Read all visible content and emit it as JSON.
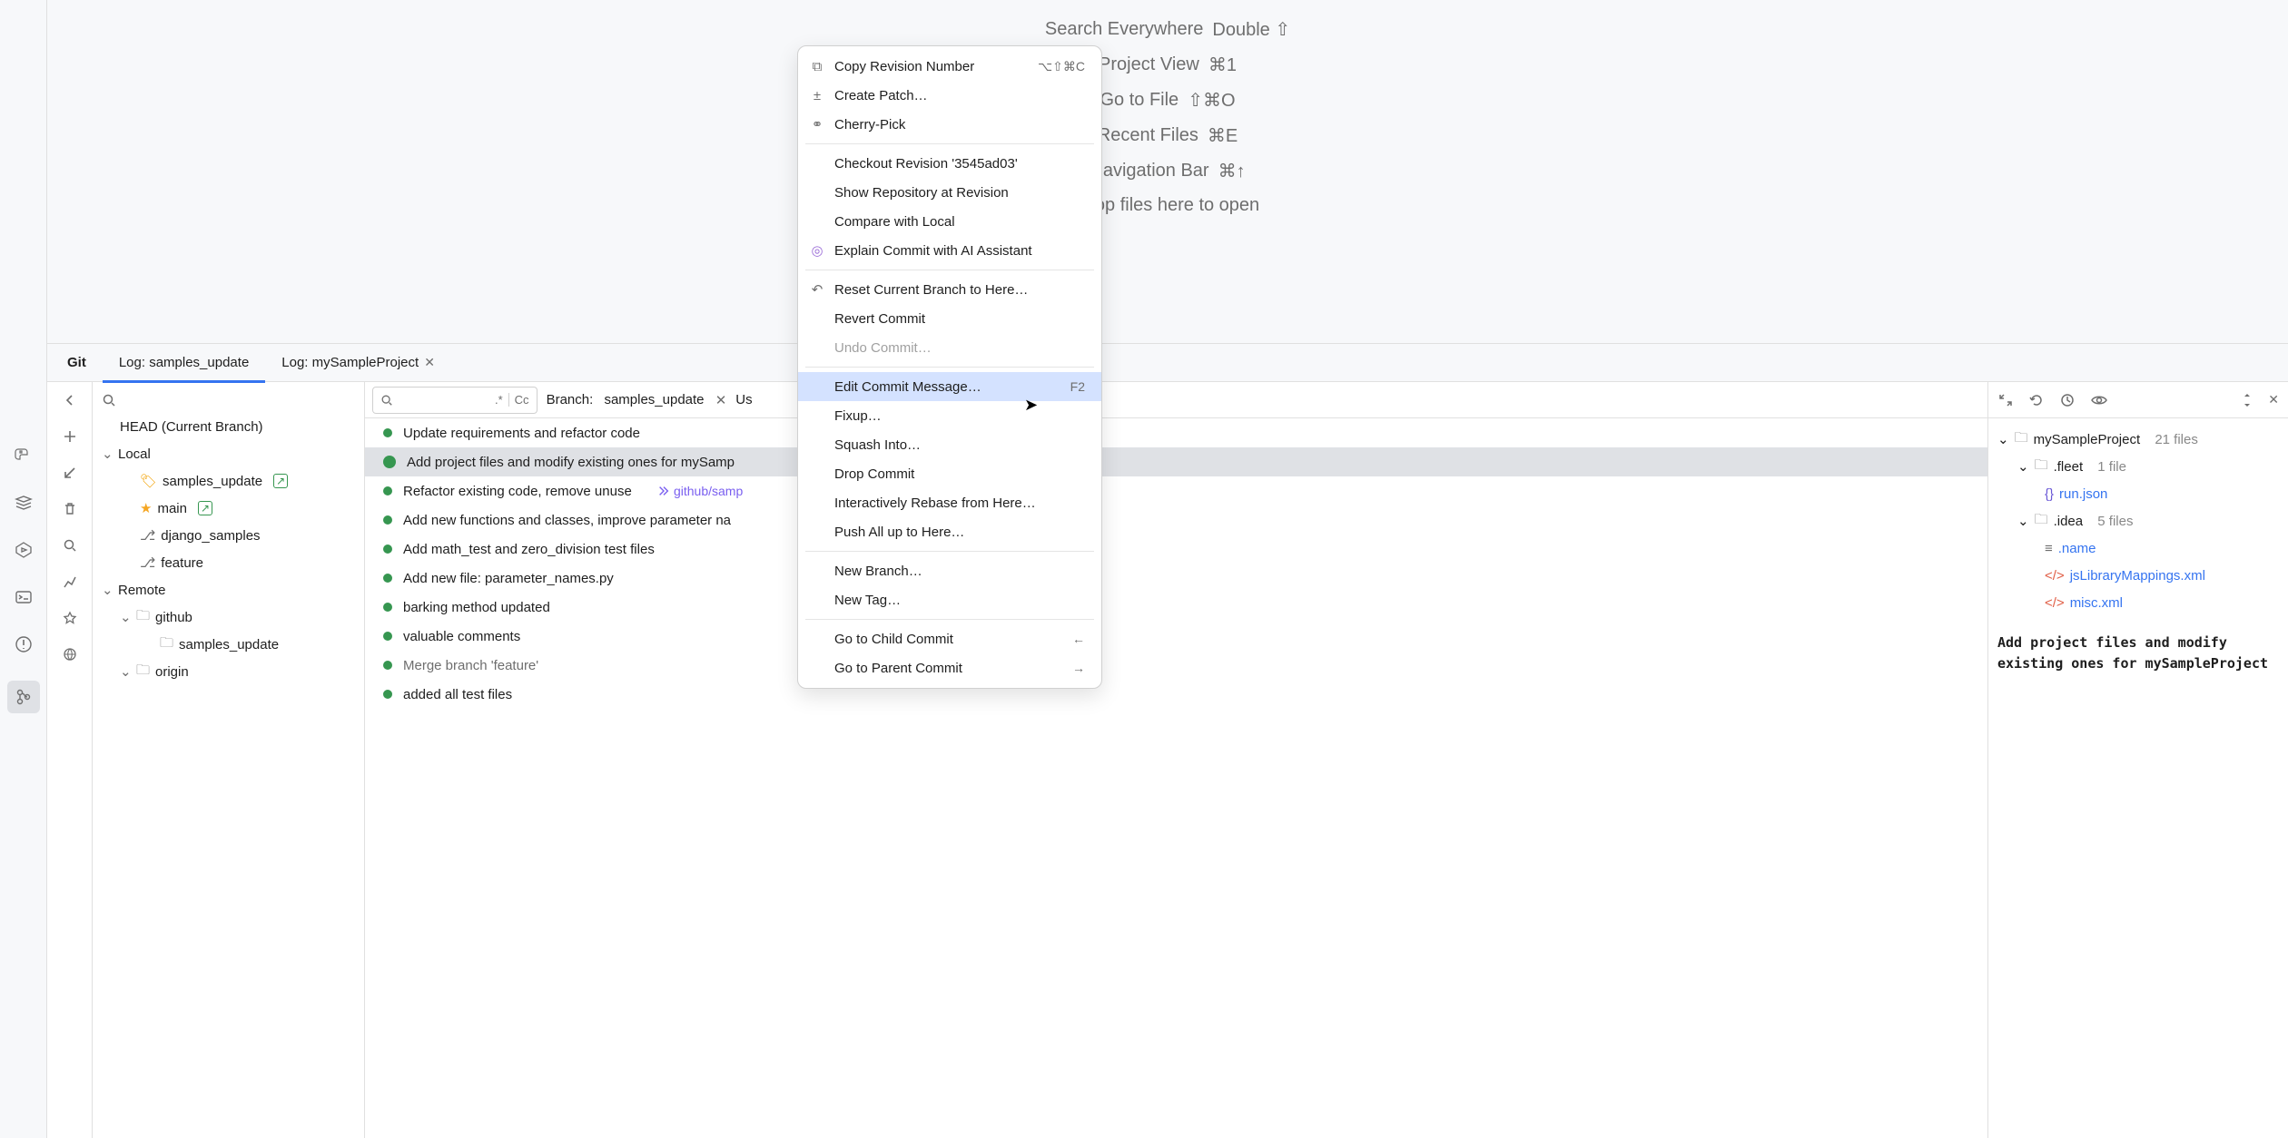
{
  "editor_tips": {
    "search": {
      "label": "Search Everywhere",
      "shortcut": "Double ⇧"
    },
    "project_view": {
      "label": "Project View",
      "shortcut": "⌘1"
    },
    "goto_file": {
      "label": "Go to File",
      "shortcut": "⇧⌘O"
    },
    "recent": {
      "label": "Recent Files",
      "shortcut": "⌘E"
    },
    "navbar": {
      "label": "Navigation Bar",
      "shortcut": "⌘↑"
    },
    "drop": {
      "label": "Drop files here to open"
    }
  },
  "tabs": {
    "git": "Git",
    "log1": "Log: samples_update",
    "log2": "Log: mySampleProject"
  },
  "branches": {
    "head": "HEAD (Current Branch)",
    "local_label": "Local",
    "remote_label": "Remote",
    "local": [
      "samples_update",
      "main",
      "django_samples",
      "feature"
    ],
    "remote_folders": [
      "github",
      "origin"
    ],
    "remote_branches": [
      "samples_update"
    ]
  },
  "filters": {
    "regex": ".*",
    "cc": "Cc",
    "branch_label": "Branch:",
    "branch_value": "samples_update",
    "user_label": "Us"
  },
  "commits": [
    {
      "msg": "Update requirements and refactor code"
    },
    {
      "msg": "Add project files and modify existing ones for mySamp",
      "selected": true
    },
    {
      "msg": "Refactor existing code, remove unuse",
      "pr": "github/samp"
    },
    {
      "msg": "Add new functions and classes, improve parameter na"
    },
    {
      "msg": "Add math_test and zero_division test files"
    },
    {
      "msg": "Add new file: parameter_names.py"
    },
    {
      "msg": "barking method updated"
    },
    {
      "msg": "valuable comments"
    },
    {
      "msg": "Merge branch 'feature'",
      "dim": true
    },
    {
      "msg": "added all test files"
    }
  ],
  "details": {
    "project": "mySampleProject",
    "project_meta": "21 files",
    "folders": [
      {
        "name": ".fleet",
        "meta": "1 file",
        "files": [
          {
            "name": "run.json",
            "type": "json"
          }
        ]
      },
      {
        "name": ".idea",
        "meta": "5 files",
        "files": [
          {
            "name": ".name",
            "type": "text"
          },
          {
            "name": "jsLibraryMappings.xml",
            "type": "xml"
          },
          {
            "name": "misc.xml",
            "type": "xml"
          }
        ]
      }
    ],
    "commit_message": "Add project files and modify existing ones for mySampleProject"
  },
  "menu": {
    "copy_rev": "Copy Revision Number",
    "copy_rev_sc": "⌥⇧⌘C",
    "create_patch": "Create Patch…",
    "cherry_pick": "Cherry-Pick",
    "checkout": "Checkout Revision '3545ad03'",
    "show_repo": "Show Repository at Revision",
    "compare": "Compare with Local",
    "explain": "Explain Commit with AI Assistant",
    "reset": "Reset Current Branch to Here…",
    "revert": "Revert Commit",
    "undo": "Undo Commit…",
    "edit_msg": "Edit Commit Message…",
    "edit_msg_sc": "F2",
    "fixup": "Fixup…",
    "squash": "Squash Into…",
    "drop": "Drop Commit",
    "rebase": "Interactively Rebase from Here…",
    "push": "Push All up to Here…",
    "new_branch": "New Branch…",
    "new_tag": "New Tag…",
    "child": "Go to Child Commit",
    "parent": "Go to Parent Commit"
  }
}
